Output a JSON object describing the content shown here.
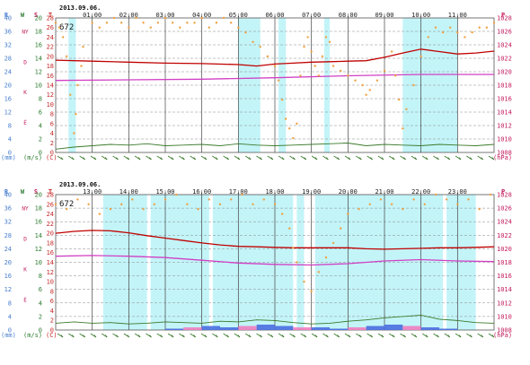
{
  "colors": {
    "R": "#4a7fd0",
    "W": "#2e7d32",
    "S": "#c2185b",
    "T": "#c62828",
    "P": "#c2185b",
    "grid": "#8a8a8a",
    "sun": "#b8f2f7",
    "wind": "#3a7a2a",
    "temp": "#c00000",
    "press": "#d13fc4",
    "humid": "#f0a040",
    "rain": "#4a6ee0",
    "rain2": "#f080c0"
  },
  "axis_letters": {
    "R": "R",
    "W": "W",
    "S": "S",
    "T": "T",
    "P": "P"
  },
  "unit_labels": {
    "mm": "(mm)",
    "ms": "(m/s)",
    "c": "(C)",
    "hpa": "(hPa)"
  },
  "compass": [
    "É",
    "K",
    "D",
    "NY"
  ],
  "date": "2013.09.06.",
  "station_id": "672",
  "chart_data": [
    {
      "type": "line",
      "panel": "top",
      "xlim": [
        0,
        12
      ],
      "hour_labels": [
        "01:00",
        "02:00",
        "03:00",
        "04:00",
        "05:00",
        "06:00",
        "07:00",
        "08:00",
        "09:00",
        "10:00",
        "11:00"
      ],
      "left_axes": {
        "R": [
          "0",
          "4",
          "8",
          "12",
          "16",
          "20",
          "24",
          "28",
          "32",
          "36",
          "40"
        ],
        "W": [
          "0",
          "2",
          "4",
          "6",
          "8",
          "10",
          "12",
          "14",
          "16",
          "18",
          "20"
        ],
        "T": [
          "0",
          "2",
          "4",
          "6",
          "8",
          "10",
          "12",
          "14",
          "16",
          "18",
          "20",
          "22",
          "24",
          "26",
          "28"
        ]
      },
      "right_axis": {
        "P": [
          "1008",
          "1010",
          "1012",
          "1014",
          "1016",
          "1018",
          "1020",
          "1022",
          "1024",
          "1026",
          "1028"
        ],
        "ylim": [
          1008,
          1028
        ]
      },
      "temp_ylim": [
        0,
        28
      ],
      "sunshine_intervals": [
        [
          0.35,
          0.55
        ],
        [
          5.0,
          5.6
        ],
        [
          6.1,
          6.3
        ],
        [
          7.35,
          7.5
        ],
        [
          9.5,
          11.0
        ]
      ],
      "series": [
        {
          "key": "temperature",
          "unit": "C",
          "x": [
            0,
            1,
            2,
            3,
            4,
            5,
            5.5,
            6,
            6.5,
            7,
            7.5,
            8,
            8.5,
            9,
            9.5,
            10,
            10.5,
            11,
            11.5,
            12
          ],
          "values": [
            19.2,
            19.0,
            18.8,
            18.6,
            18.5,
            18.3,
            18.0,
            18.4,
            18.6,
            18.8,
            18.9,
            19.0,
            19.1,
            19.8,
            20.7,
            21.5,
            21.0,
            20.5,
            20.7,
            21.1
          ]
        },
        {
          "key": "pressure",
          "unit": "hPa",
          "x": [
            0,
            2,
            4,
            6,
            8,
            10,
            12
          ],
          "values": [
            1018.7,
            1018.8,
            1018.9,
            1019.1,
            1019.4,
            1019.6,
            1019.6
          ]
        },
        {
          "key": "wind",
          "unit": "m/s",
          "x": [
            0,
            0.5,
            1,
            1.5,
            2,
            2.5,
            3,
            3.5,
            4,
            4.5,
            5,
            5.5,
            6,
            6.5,
            7,
            7.5,
            8,
            8.5,
            9,
            9.5,
            10,
            10.5,
            11,
            11.5,
            12
          ],
          "values": [
            0.5,
            0.8,
            1.0,
            1.2,
            1.1,
            1.3,
            1.0,
            1.1,
            1.2,
            1.0,
            1.3,
            1.1,
            1.0,
            1.1,
            1.2,
            1.3,
            1.4,
            1.0,
            1.2,
            1.1,
            1.0,
            1.2,
            1.1,
            1.0,
            1.2
          ]
        },
        {
          "key": "humidity",
          "x": [
            0.0,
            0.1,
            0.2,
            0.3,
            0.4,
            0.5,
            0.55,
            0.6,
            0.7,
            0.75,
            1.0,
            1.2,
            1.4,
            1.6,
            1.8,
            2.0,
            2.2,
            2.4,
            2.6,
            2.8,
            3.0,
            3.2,
            3.4,
            3.6,
            3.8,
            4.0,
            4.2,
            4.4,
            4.6,
            4.8,
            5.0,
            5.2,
            5.4,
            5.6,
            5.8,
            6.0,
            6.1,
            6.2,
            6.3,
            6.4,
            6.5,
            6.6,
            6.7,
            6.8,
            6.9,
            7.0,
            7.1,
            7.2,
            7.3,
            7.4,
            7.5,
            7.6,
            7.8,
            8.0,
            8.2,
            8.4,
            8.5,
            8.6,
            8.8,
            9.0,
            9.2,
            9.3,
            9.4,
            9.5,
            9.6,
            9.8,
            10.0,
            10.2,
            10.4,
            10.6,
            10.8,
            11.0,
            11.2,
            11.4,
            11.6,
            11.8,
            12.0
          ],
          "values": [
            27,
            26,
            24,
            20,
            12,
            4,
            8,
            14,
            18,
            22,
            27,
            26,
            27,
            28,
            27,
            26,
            28,
            27,
            26,
            27,
            28,
            27,
            26,
            27,
            27,
            28,
            26,
            27,
            28,
            27,
            26,
            25,
            23,
            22,
            20,
            18,
            15,
            11,
            7,
            5,
            3,
            6,
            16,
            22,
            24,
            21,
            18,
            16,
            20,
            24,
            23,
            18,
            17,
            16,
            15,
            14,
            12,
            13,
            15,
            17,
            21,
            16,
            11,
            5,
            9,
            14,
            20,
            24,
            26,
            25,
            26,
            25,
            24,
            25,
            26,
            26,
            27
          ]
        }
      ]
    },
    {
      "type": "line",
      "panel": "bottom",
      "xlim": [
        12,
        24
      ],
      "hour_labels": [
        "13:00",
        "14:00",
        "15:00",
        "16:00",
        "17:00",
        "18:00",
        "19:00",
        "20:00",
        "21:00",
        "22:00",
        "23:00"
      ],
      "left_axes": {
        "R": [
          "0",
          "4",
          "8",
          "12",
          "16",
          "20",
          "24",
          "28",
          "32",
          "36",
          "40"
        ],
        "W": [
          "0",
          "2",
          "4",
          "6",
          "8",
          "10",
          "12",
          "14",
          "16",
          "18",
          "20"
        ],
        "T": [
          "0",
          "2",
          "4",
          "6",
          "8",
          "10",
          "12",
          "14",
          "16",
          "18",
          "20",
          "22",
          "24",
          "26",
          "28"
        ]
      },
      "right_axis": {
        "P": [
          "1008",
          "1010",
          "1012",
          "1014",
          "1016",
          "1018",
          "1020",
          "1022",
          "1024",
          "1026",
          "1028"
        ],
        "ylim": [
          1008,
          1028
        ]
      },
      "temp_ylim": [
        0,
        28
      ],
      "sunshine_intervals": [
        [
          13.3,
          14.5
        ],
        [
          14.6,
          16.2
        ],
        [
          16.3,
          18.5
        ],
        [
          18.6,
          18.8
        ],
        [
          19.1,
          22.6
        ],
        [
          22.7,
          23.5
        ]
      ],
      "series": [
        {
          "key": "temperature",
          "unit": "C",
          "x": [
            12,
            12.5,
            13,
            13.5,
            14,
            14.5,
            15,
            15.5,
            16,
            16.5,
            17,
            17.5,
            18,
            18.5,
            19,
            19.5,
            20,
            20.5,
            21,
            21.5,
            22,
            22.5,
            23,
            23.5,
            24
          ],
          "values": [
            20.0,
            20.4,
            20.6,
            20.5,
            20.1,
            19.5,
            19.0,
            18.5,
            18.0,
            17.6,
            17.3,
            17.2,
            17.1,
            17.0,
            17.0,
            17.0,
            17.0,
            16.8,
            16.7,
            16.8,
            16.9,
            17.0,
            17.0,
            17.1,
            17.2
          ]
        },
        {
          "key": "pressure",
          "unit": "hPa",
          "x": [
            12,
            13,
            14,
            15,
            16,
            17,
            18,
            19,
            20,
            21,
            22,
            23,
            24
          ],
          "values": [
            1018.9,
            1019.0,
            1018.9,
            1018.7,
            1018.3,
            1017.9,
            1017.7,
            1017.6,
            1017.8,
            1018.2,
            1018.4,
            1018.2,
            1018.1
          ]
        },
        {
          "key": "wind",
          "unit": "m/s",
          "x": [
            12,
            12.5,
            13,
            13.5,
            14,
            14.5,
            15,
            15.5,
            16,
            16.5,
            17,
            17.5,
            18,
            18.5,
            19,
            19.5,
            20,
            20.5,
            21,
            21.5,
            22,
            22.5,
            23,
            23.5,
            24
          ],
          "values": [
            1.0,
            1.2,
            1.0,
            1.1,
            0.9,
            1.0,
            1.2,
            1.1,
            1.0,
            1.3,
            1.2,
            1.5,
            1.4,
            1.1,
            0.9,
            1.0,
            1.3,
            1.5,
            1.8,
            2.0,
            2.2,
            1.6,
            1.4,
            1.1,
            1.0
          ]
        },
        {
          "key": "humidity",
          "x": [
            12.0,
            12.3,
            12.6,
            12.9,
            13.2,
            13.5,
            13.8,
            14.1,
            14.4,
            14.7,
            15.0,
            15.3,
            15.6,
            15.9,
            16.2,
            16.5,
            16.8,
            17.1,
            17.4,
            17.7,
            18.0,
            18.2,
            18.4,
            18.5,
            18.6,
            18.8,
            19.0,
            19.2,
            19.4,
            19.6,
            19.8,
            20.0,
            20.3,
            20.6,
            20.9,
            21.2,
            21.5,
            21.8,
            22.1,
            22.4,
            22.7,
            23.0,
            23.3,
            23.6,
            23.9
          ],
          "values": [
            26,
            25,
            27,
            26,
            24,
            25,
            26,
            27,
            25,
            26,
            27,
            28,
            26,
            25,
            27,
            26,
            27,
            28,
            26,
            27,
            26,
            24,
            21,
            17,
            14,
            10,
            8,
            12,
            15,
            18,
            21,
            24,
            25,
            26,
            27,
            26,
            25,
            27,
            26,
            28,
            27,
            26,
            27,
            25,
            28
          ]
        },
        {
          "key": "rain",
          "unit": "mm",
          "x": [
            15.0,
            15.5,
            16.0,
            16.5,
            17.0,
            17.5,
            18.0,
            18.5,
            19.0,
            19.5,
            20.0,
            20.5,
            21.0,
            21.5,
            22.0,
            22.5,
            23.0
          ],
          "values": [
            0.4,
            0.8,
            1.2,
            0.8,
            1.2,
            1.6,
            1.2,
            0.8,
            0.8,
            0.4,
            0.8,
            1.2,
            1.6,
            1.2,
            0.8,
            0.4,
            0
          ]
        }
      ]
    }
  ]
}
